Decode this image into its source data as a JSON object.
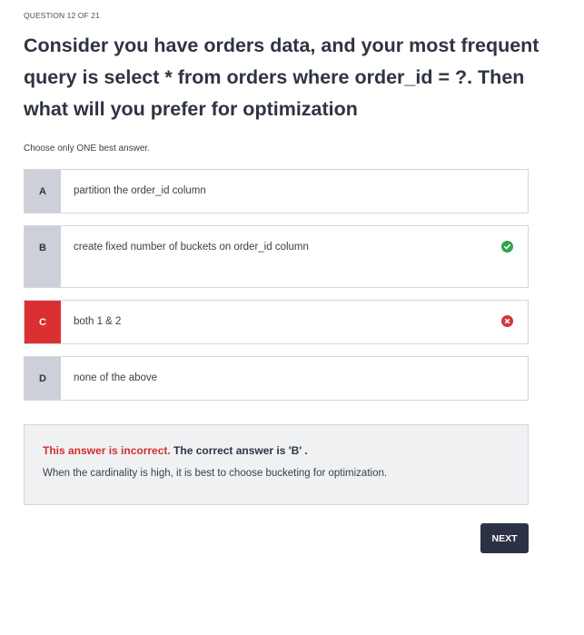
{
  "quiz": {
    "counter": "QUESTION 12 OF 21",
    "question": "Consider you have orders data, and your most frequent query is select * from orders where order_id = ?. Then what will you prefer for optimization",
    "instruction": "Choose only ONE best answer."
  },
  "options": [
    {
      "letter": "A",
      "text": "partition the order_id column",
      "state": "neutral"
    },
    {
      "letter": "B",
      "text": "create fixed number of buckets on order_id column",
      "state": "correct",
      "icon": "check-circle-icon"
    },
    {
      "letter": "C",
      "text": "both 1 & 2",
      "state": "selected-incorrect",
      "icon": "x-circle-icon"
    },
    {
      "letter": "D",
      "text": "none of the above",
      "state": "neutral"
    }
  ],
  "feedback": {
    "status": "This answer is incorrect.",
    "correct_answer": " The correct answer is 'B' .",
    "explanation": "When the cardinality is high, it is best to choose bucketing for optimization."
  },
  "actions": {
    "next_label": "NEXT"
  },
  "colors": {
    "correct": "#2ea44f",
    "incorrect": "#dc2f32",
    "letter_bg": "#cdd0d9",
    "next_button": "#2d3145",
    "feedback_bg": "#f0f1f3"
  }
}
